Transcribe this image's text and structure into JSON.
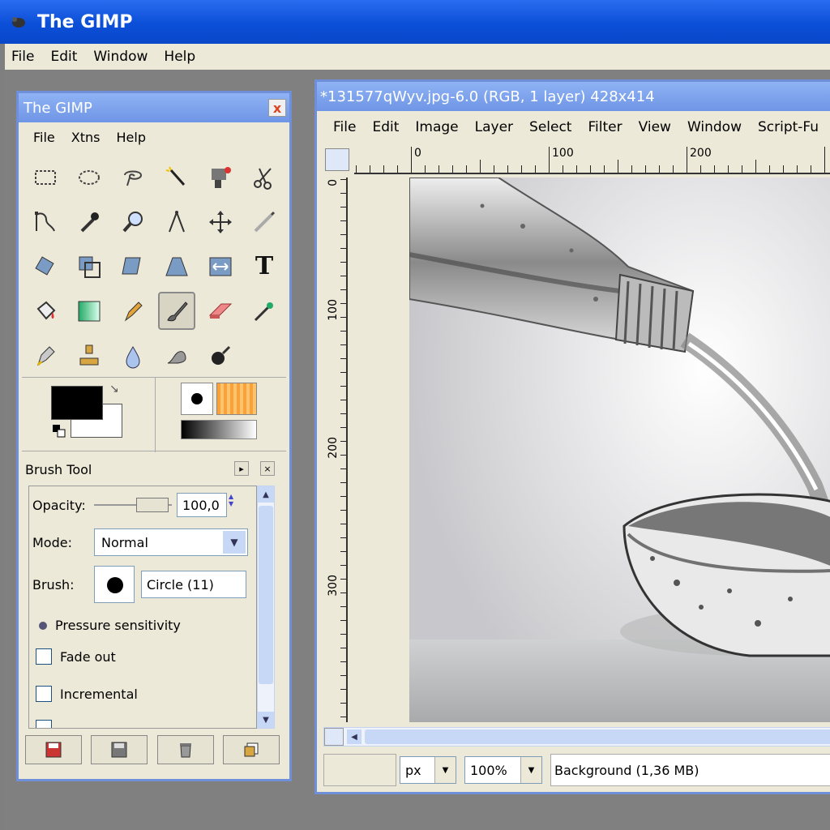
{
  "app": {
    "title": "The GIMP"
  },
  "main_menu": [
    "File",
    "Edit",
    "Window",
    "Help"
  ],
  "toolbox": {
    "title": "The GIMP",
    "close": "x",
    "menu": [
      "File",
      "Xtns",
      "Help"
    ],
    "text_tool_glyph": "T"
  },
  "brush_tool": {
    "title": "Brush Tool",
    "opacity_label": "Opacity:",
    "opacity_value": "100,0",
    "mode_label": "Mode:",
    "mode_value": "Normal",
    "brush_label": "Brush:",
    "brush_value": "Circle (11)",
    "pressure_label": "Pressure sensitivity",
    "fade_label": "Fade out",
    "incremental_label": "Incremental"
  },
  "image_window": {
    "title": "*131577qWyv.jpg-6.0 (RGB, 1 layer) 428x414",
    "menu": [
      "File",
      "Edit",
      "Image",
      "Layer",
      "Select",
      "Filter",
      "View",
      "Window",
      "Script-Fu"
    ],
    "ruler_h": [
      "0",
      "100",
      "200"
    ],
    "ruler_v": [
      "0",
      "100",
      "200",
      "300"
    ],
    "unit": "px",
    "zoom": "100%",
    "status": "Background (1,36 MB)"
  },
  "colors": {
    "titlebar": "#0b4fd8",
    "panel": "#ece9d8",
    "active_titlebar": "#7aa0ec"
  }
}
